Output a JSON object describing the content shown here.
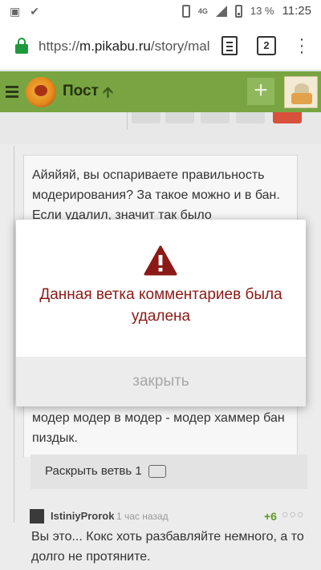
{
  "statusbar": {
    "battery_percent": "13 %",
    "network_label": "4G",
    "time": "11:25",
    "icons": [
      "image-icon",
      "check-icon",
      "phone-icon",
      "signal-icon",
      "battery-icon"
    ]
  },
  "browser": {
    "url_prefix": "https://",
    "url_host": "m.pikabu.ru",
    "url_path": "/story/mal",
    "tabs_count": "2",
    "lock_color": "#1e9a3c"
  },
  "header": {
    "title": "Пост",
    "accent_color": "#78a542",
    "add_label": "+"
  },
  "comments": {
    "first_text": "Айяйяй, вы оспариваете правильность модерирования? За такое можно и в бан. Если удалил, значит так было",
    "second_text": "Видит модер – в речке модер. Сунул модер модер в модер - модер хаммер бан пиздык.",
    "expand_label": "Раскрыть ветвь 1",
    "third": {
      "user": "IstiniyProrok",
      "time": "1 час назад",
      "rating": "+6",
      "text": "Вы это... Кокс хоть разбавляйте немного, а то долго не протяните."
    }
  },
  "dialog": {
    "message": "Данная ветка комментариев была удалена",
    "close_label": "закрыть",
    "message_color": "#8b1a16",
    "icon": "warning-icon"
  }
}
